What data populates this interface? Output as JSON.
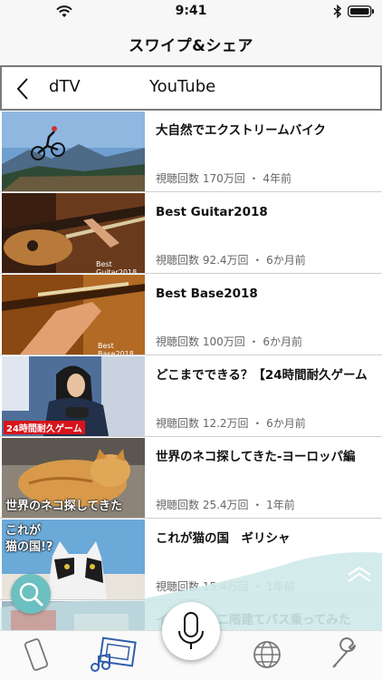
{
  "status_bar": {
    "time": "9:41"
  },
  "nav": {
    "title": "スワイプ&シェア"
  },
  "tabs": [
    {
      "label": "dTV"
    },
    {
      "label": "YouTube"
    }
  ],
  "videos": [
    {
      "title": "大自然でエクストリームバイク",
      "meta": "視聴回数 170万回 ・ 4年前",
      "thumb_caption": ""
    },
    {
      "title": "Best Guitar2018",
      "meta": "視聴回数 92.4万回 ・ 6か月前",
      "thumb_caption": "Best Guitar2018"
    },
    {
      "title": "Best Base2018",
      "meta": "視聴回数 100万回 ・ 6か月前",
      "thumb_caption": "Best Base2018"
    },
    {
      "title": "どこまでできる？【24時間耐久ゲーム",
      "meta": "視聴回数 12.2万回 ・ 6か月前",
      "thumb_caption": "24時間耐久ゲーム"
    },
    {
      "title": "世界のネコ探してきた-ヨーロッパ編",
      "meta": "視聴回数 25.4万回 ・ 1年前",
      "thumb_caption": "世界のネコ探してきた"
    },
    {
      "title": "これが猫の国　ギリシャ",
      "meta": "視聴回数 15.4万回 ・ 1年前",
      "thumb_caption_line1": "これが",
      "thumb_caption_line2": "猫の国!?"
    },
    {
      "title": "イ　　　　二階建てバス乗ってみた",
      "meta": ""
    }
  ],
  "colors": {
    "accent_teal": "#6cc0c0",
    "wave": "#cfe9e9",
    "icon_blue": "#2f5da8"
  },
  "bottom_bar": {
    "icons": [
      "phone-icon",
      "media-icon",
      "mic-icon",
      "globe-icon",
      "wrench-icon"
    ]
  }
}
